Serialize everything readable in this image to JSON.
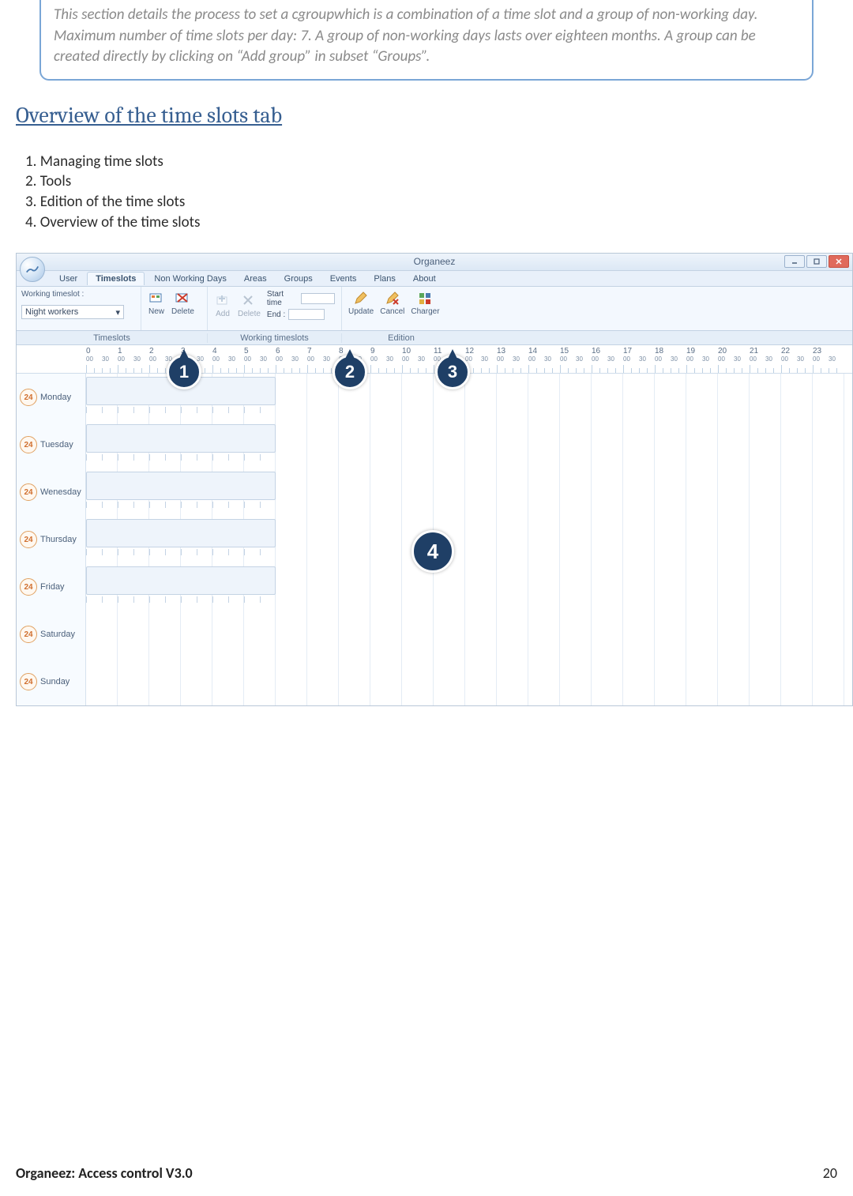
{
  "note": "This section details the process to set a cgroupwhich is a combination of a time slot and a group of non-working day. Maximum number of time slots per day: 7. A group of non-working days lasts over eighteen months. A group can be created directly by clicking on “Add group” in subset “Groups”.",
  "section_title": "Overview of the time slots tab",
  "list": {
    "i1": "1. Managing time slots",
    "i2": "2. Tools",
    "i3": "3. Edition of the time slots",
    "i4": "4. Overview of the time slots"
  },
  "app": {
    "title": "Organeez",
    "menu": {
      "user": "User",
      "timeslots": "Timeslots",
      "nonworking": "Non Working Days",
      "areas": "Areas",
      "groups": "Groups",
      "events": "Events",
      "plans": "Plans",
      "about": "About"
    },
    "ribbon": {
      "working_label": "Working timeslot :",
      "working_value": "Night workers",
      "new": "New",
      "delete": "Delete",
      "add": "Add",
      "delete2": "Delete",
      "start": "Start time",
      "end": "End :",
      "update": "Update",
      "cancel": "Cancel",
      "charger": "Charger"
    },
    "group_footer": {
      "timeslots": "Timeslots",
      "working": "Working timeslots",
      "edition": "Edition"
    },
    "hours": [
      "0",
      "1",
      "2",
      "3",
      "4",
      "5",
      "6",
      "7",
      "8",
      "9",
      "10",
      "11",
      "12",
      "13",
      "14",
      "15",
      "16",
      "17",
      "18",
      "19",
      "20",
      "21",
      "22",
      "23"
    ],
    "sub": {
      "a": "00",
      "b": "30"
    },
    "days": {
      "mon": "Monday",
      "tue": "Tuesday",
      "wed": "Wenesday",
      "thu": "Thursday",
      "fri": "Friday",
      "sat": "Saturday",
      "sun": "Sunday"
    },
    "clock_label": "24",
    "callouts": {
      "b1": "1",
      "b2": "2",
      "b3": "3",
      "b4": "4"
    }
  },
  "footer": {
    "doc": "Organeez: Access control    V3.0",
    "page": "20"
  }
}
